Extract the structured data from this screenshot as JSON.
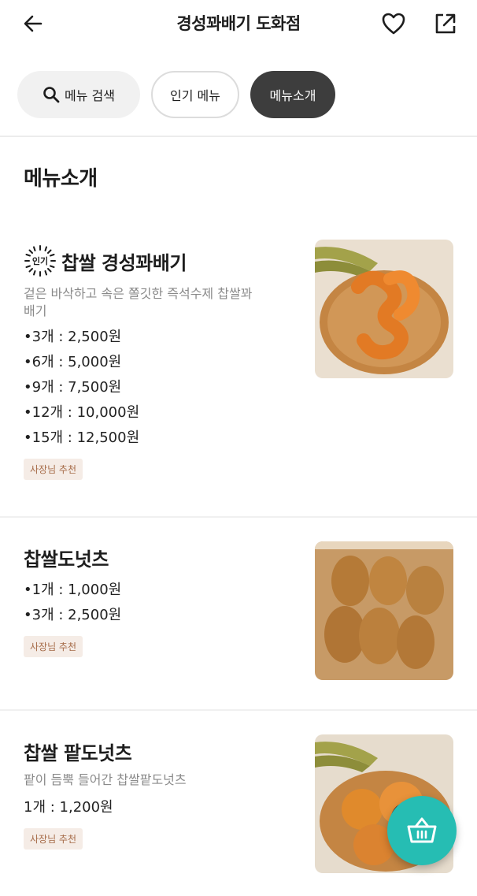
{
  "header": {
    "title": "경성꽈배기 도화점"
  },
  "filters": {
    "search_label": "메뉴 검색",
    "popular_label": "인기 메뉴",
    "intro_label": "메뉴소개"
  },
  "section": {
    "title": "메뉴소개"
  },
  "items": [
    {
      "badge": "인기",
      "name": "찹쌀 경성꽈배기",
      "description": "겉은 바삭하고 속은 쫄깃한 즉석수제 찹쌀꽈배기",
      "prices": [
        "•3개 : 2,500원",
        "•6개 : 5,000원",
        "•9개 : 7,500원",
        "•12개 : 10,000원",
        "•15개 : 12,500원"
      ],
      "tag": "사장님 추천"
    },
    {
      "name": "찹쌀도넛츠",
      "prices": [
        "•1개 : 1,000원",
        "•3개 : 2,500원"
      ],
      "tag": "사장님 추천"
    },
    {
      "name": "찹쌀 팥도넛츠",
      "description": "팥이 듬뿍 들어간 찹쌀팥도넛츠",
      "prices": [
        "1개 : 1,200원"
      ],
      "tag": "사장님 추천"
    }
  ],
  "icons": {
    "back": "arrow-left-icon",
    "favorite": "heart-icon",
    "share": "share-icon",
    "search": "search-icon",
    "cart": "basket-icon"
  },
  "colors": {
    "accent": "#26bdb3",
    "active_chip": "#3d3d3d",
    "tag_bg": "#f5ece6",
    "tag_text": "#a66b48"
  }
}
